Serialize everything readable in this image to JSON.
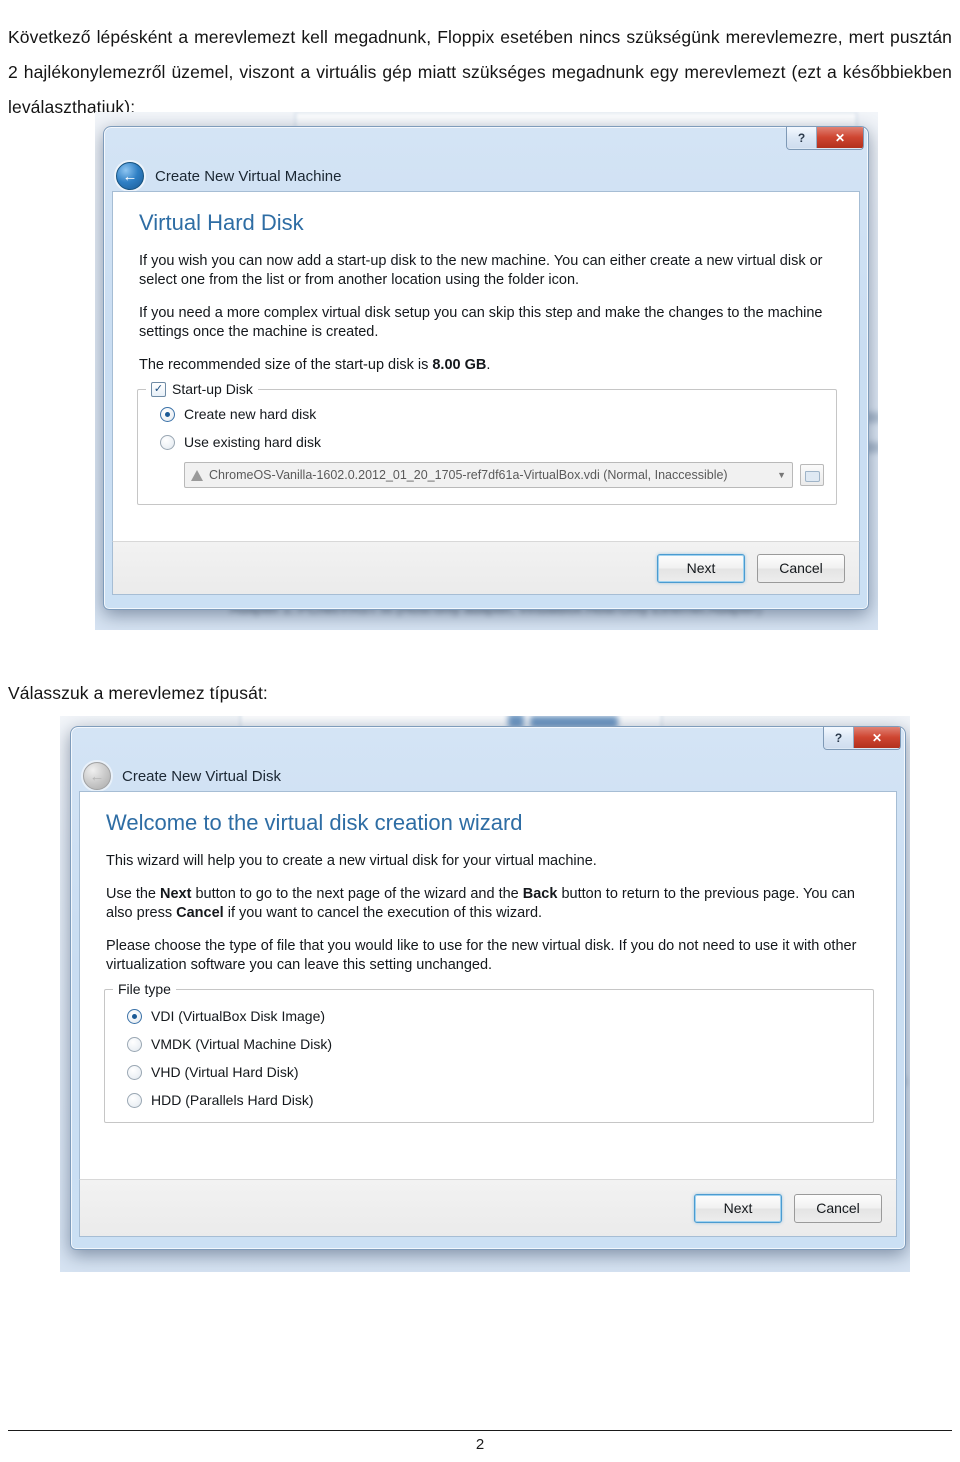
{
  "document": {
    "paragraphs": {
      "intro": "Következő lépésként a merevlemezt kell megadnunk, Floppix esetében nincs szükségünk merevlemezre, mert pusztán 2 hajlékonylemezről üzemel, viszont a virtuális gép miatt szükséges megadnunk egy merevlemezt (ezt a későbbiekben leválaszthatjuk):",
      "caption2": "Válasszuk a merevlemez típusát:"
    },
    "page_number": "2"
  },
  "dialog_virtual_hard_disk": {
    "titlebar": {
      "help_label": "?",
      "close_label": "✕"
    },
    "nav": {
      "back_arrow": "←",
      "title": "Create New Virtual Machine"
    },
    "heading": "Virtual Hard Disk",
    "paragraphs": [
      "If you wish you can now add a start-up disk to the new machine. You can either create a new virtual disk or select one from the list or from another location using the folder icon.",
      "If you need a more complex virtual disk setup you can skip this step and make the changes to the machine settings once the machine is created."
    ],
    "recommended_size_text_prefix": "The recommended size of the start-up disk is ",
    "recommended_size_value": "8.00 GB",
    "recommended_size_text_suffix": ".",
    "groupbox": {
      "legend": "Start-up Disk",
      "checkbox_checked": true,
      "checkbox_glyph": "✓"
    },
    "options": [
      {
        "label": "Create new hard disk",
        "selected": true
      },
      {
        "label": "Use existing hard disk",
        "selected": false
      }
    ],
    "combo": {
      "value": "ChromeOS-Vanilla-1602.0.2012_01_20_1705-ref7df61a-VirtualBox.vdi (Normal, Inaccessible)",
      "arrow": "▼",
      "warning_icon": "warning-triangle"
    },
    "buttons": {
      "next": "Next",
      "cancel": "Cancel"
    },
    "background": {
      "line1": "Adapter 1: PCnet-FAST III (Host-only adapter, VirtualBox Host-Only Ethernet Adapter)"
    }
  },
  "dialog_create_new_virtual_disk": {
    "titlebar": {
      "help_label": "?",
      "close_label": "✕"
    },
    "nav": {
      "back_arrow": "←",
      "title": "Create New Virtual Disk",
      "back_disabled": true
    },
    "heading": "Welcome to the virtual disk creation wizard",
    "paragraphs": [
      "This wizard will help you to create a new virtual disk for your virtual machine.",
      "Please choose the type of file that you would like to use for the new virtual disk. If you do not need to use it with other virtualization software you can leave this setting unchanged."
    ],
    "nav_paragraph": {
      "part1": "Use the ",
      "bold1": "Next",
      "part2": " button to go to the next page of the wizard and the ",
      "bold2": "Back",
      "part3": " button to return to the previous page. You can also press ",
      "bold3": "Cancel",
      "part4": " if you want to cancel the execution of this wizard."
    },
    "groupbox": {
      "legend": "File type"
    },
    "options": [
      {
        "label": "VDI (VirtualBox Disk Image)",
        "selected": true
      },
      {
        "label": "VMDK (Virtual Machine Disk)",
        "selected": false
      },
      {
        "label": "VHD (Virtual Hard Disk)",
        "selected": false
      },
      {
        "label": "HDD (Parallels Hard Disk)",
        "selected": false
      }
    ],
    "buttons": {
      "next": "Next",
      "cancel": "Cancel"
    }
  }
}
